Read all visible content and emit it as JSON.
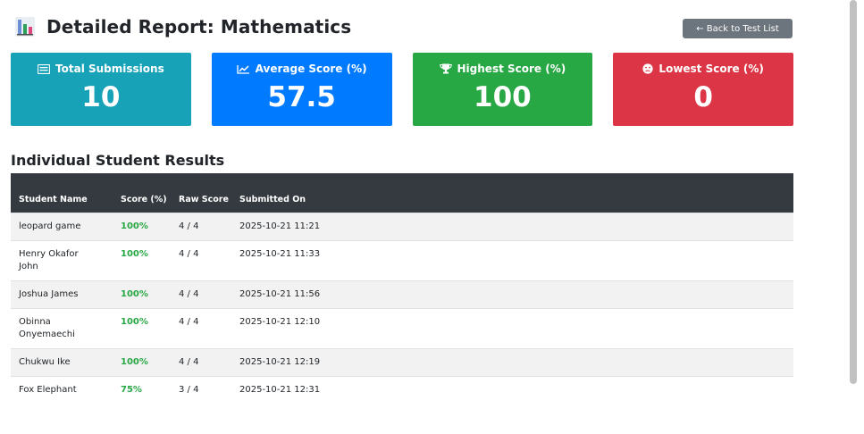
{
  "header": {
    "icon": "bar-chart-icon",
    "title": "Detailed Report: Mathematics",
    "back_label": "← Back to Test List"
  },
  "cards": [
    {
      "label": "Total Submissions",
      "value": "10",
      "icon": "list-icon",
      "color": "#17a2b8"
    },
    {
      "label": "Average Score (%)",
      "value": "57.5",
      "icon": "line-chart-icon",
      "color": "#007bff"
    },
    {
      "label": "Highest Score (%)",
      "value": "100",
      "icon": "trophy-icon",
      "color": "#28a745"
    },
    {
      "label": "Lowest Score (%)",
      "value": "0",
      "icon": "frown-icon",
      "color": "#dc3545"
    }
  ],
  "results": {
    "title": "Individual Student Results",
    "columns": [
      "Student Name",
      "Score (%)",
      "Raw Score",
      "Submitted On"
    ],
    "rows": [
      {
        "name": "leopard game",
        "score": "100%",
        "raw": "4 / 4",
        "submitted": "2025-10-21 11:21"
      },
      {
        "name": "Henry Okafor John",
        "score": "100%",
        "raw": "4 / 4",
        "submitted": "2025-10-21 11:33"
      },
      {
        "name": "Joshua James",
        "score": "100%",
        "raw": "4 / 4",
        "submitted": "2025-10-21 11:56"
      },
      {
        "name": "Obinna Onyemaechi",
        "score": "100%",
        "raw": "4 / 4",
        "submitted": "2025-10-21 12:10"
      },
      {
        "name": "Chukwu Ike",
        "score": "100%",
        "raw": "4 / 4",
        "submitted": "2025-10-21 12:19"
      },
      {
        "name": "Fox Elephant",
        "score": "75%",
        "raw": "3 / 4",
        "submitted": "2025-10-21 12:31"
      }
    ]
  },
  "colors": {
    "header_bg": "#343a40",
    "success": "#28a745",
    "secondary": "#6c757d"
  }
}
